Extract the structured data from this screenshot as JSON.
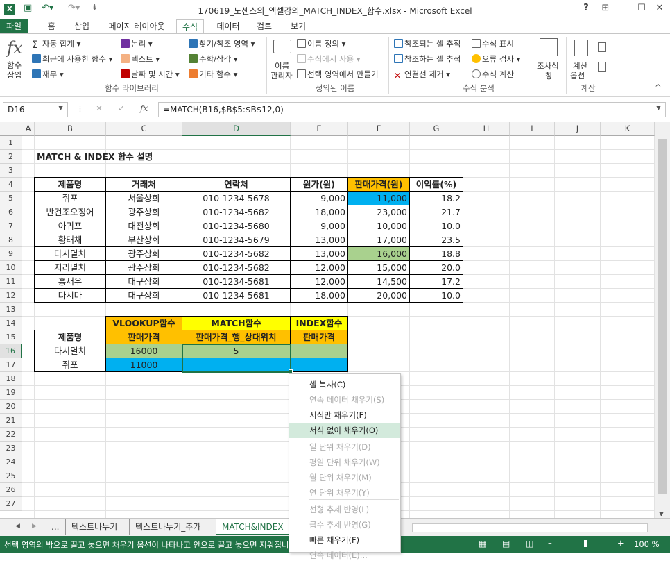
{
  "window": {
    "title": "170619_노센스의_엑셀강의_MATCH_INDEX_함수.xlsx - Microsoft Excel",
    "help": "?",
    "ribbon_options": "⊞",
    "minimize": "–",
    "restore": "☐",
    "close": "✕"
  },
  "tabs": [
    "파일",
    "홈",
    "삽입",
    "페이지 레이아웃",
    "수식",
    "데이터",
    "검토",
    "보기"
  ],
  "ribbon": {
    "insert_function": "함수\n삽입",
    "fx": "fx",
    "autosum": "자동 합계",
    "recent": "최근에 사용한 함수",
    "financial": "재무",
    "logical": "논리",
    "text": "텍스트",
    "datetime": "날짜 및 시간",
    "lookup": "찾기/참조 영역",
    "math": "수학/삼각",
    "more": "기타 함수",
    "group1": "함수 라이브러리",
    "name_manager_1": "이름",
    "name_manager_2": "관리자",
    "define_name": "이름 정의",
    "use_in_formula": "수식에서 사용",
    "create_from_sel": "선택 영역에서 만들기",
    "group2": "정의된 이름",
    "trace_precedents": "참조되는 셀 추적",
    "trace_dependents": "참조하는 셀 추적",
    "remove_arrows": "연결선 제거",
    "show_formulas": "수식 표시",
    "error_check": "오류 검사",
    "evaluate": "수식 계산",
    "watch_1": "조사식",
    "watch_2": "창",
    "group3": "수식 분석",
    "calc_options_1": "계산",
    "calc_options_2": "옵션",
    "group4": "계산",
    "collapse": "^"
  },
  "formula_bar": {
    "name_box": "D16",
    "fx": "fx",
    "cancel": "✕",
    "enter": "✓",
    "formula": "=MATCH(B16,$B$5:$B$12,0)"
  },
  "columns": [
    "A",
    "B",
    "C",
    "D",
    "E",
    "F",
    "G",
    "H",
    "I",
    "J",
    "K"
  ],
  "rows": [
    "1",
    "2",
    "3",
    "4",
    "5",
    "6",
    "7",
    "8",
    "9",
    "10",
    "11",
    "12",
    "13",
    "14",
    "15",
    "16",
    "17",
    "18",
    "19",
    "20",
    "21",
    "22",
    "23",
    "24",
    "25",
    "26",
    "27"
  ],
  "sheet": {
    "heading": "MATCH & INDEX 함수 설명",
    "table_headers": [
      "제품명",
      "거래처",
      "연락처",
      "원가(원)",
      "판매가격(원)",
      "이익률(%)"
    ],
    "table_rows": [
      [
        "쥐포",
        "서울상회",
        "010-1234-5678",
        "9,000",
        "11,000",
        "18.2"
      ],
      [
        "반건조오징어",
        "광주상회",
        "010-1234-5682",
        "18,000",
        "23,000",
        "21.7"
      ],
      [
        "아귀포",
        "대전상회",
        "010-1234-5680",
        "9,000",
        "10,000",
        "10.0"
      ],
      [
        "황태채",
        "부산상회",
        "010-1234-5679",
        "13,000",
        "17,000",
        "23.5"
      ],
      [
        "다시멸치",
        "광주상회",
        "010-1234-5682",
        "13,000",
        "16,000",
        "18.8"
      ],
      [
        "지리멸치",
        "광주상회",
        "010-1234-5682",
        "12,000",
        "15,000",
        "20.0"
      ],
      [
        "홍새우",
        "대구상회",
        "010-1234-5681",
        "12,000",
        "14,500",
        "17.2"
      ],
      [
        "다시마",
        "대구상회",
        "010-1234-5681",
        "18,000",
        "20,000",
        "10.0"
      ]
    ],
    "lookup_titles": [
      "VLOOKUP함수",
      "MATCH함수",
      "INDEX함수"
    ],
    "lookup_headers": [
      "제품명",
      "판매가격",
      "판매가격_행_상대위치",
      "판매가격"
    ],
    "lookup_rows": [
      [
        "다시멸치",
        "16000",
        "5",
        ""
      ],
      [
        "쥐포",
        "11000",
        "",
        ""
      ]
    ]
  },
  "colors": {
    "excel_green": "#217346",
    "orange": "#ffc000",
    "yellow": "#ffff00",
    "blue": "#00b0f0",
    "green_fill": "#a9d18e"
  },
  "context_menu": [
    {
      "label": "셀 복사(C)",
      "enabled": true
    },
    {
      "label": "연속 데이터 채우기(S)",
      "enabled": false
    },
    {
      "label": "서식만 채우기(F)",
      "enabled": true
    },
    {
      "label": "서식 없이 채우기(O)",
      "enabled": true,
      "highlighted": true
    },
    {
      "label": "일 단위 채우기(D)",
      "enabled": false
    },
    {
      "label": "평일 단위 채우기(W)",
      "enabled": false
    },
    {
      "label": "월 단위 채우기(M)",
      "enabled": false
    },
    {
      "label": "연 단위 채우기(Y)",
      "enabled": false
    },
    {
      "label": "선형 추세 반영(L)",
      "enabled": false
    },
    {
      "label": "급수 추세 반영(G)",
      "enabled": false
    },
    {
      "label": "빠른 채우기(F)",
      "enabled": true
    },
    {
      "label": "연속 데이터(E)...",
      "enabled": false
    }
  ],
  "sheet_tabs": [
    "...",
    "텍스트나누기",
    "텍스트나누기_추가",
    "MATCH&INDEX"
  ],
  "status": {
    "message": "선택 영역의 밖으로 끌고 놓으면 채우기 옵션이 나타나고 안으로 끌고 놓으면 지워집니다.",
    "zoom": "100 %"
  }
}
